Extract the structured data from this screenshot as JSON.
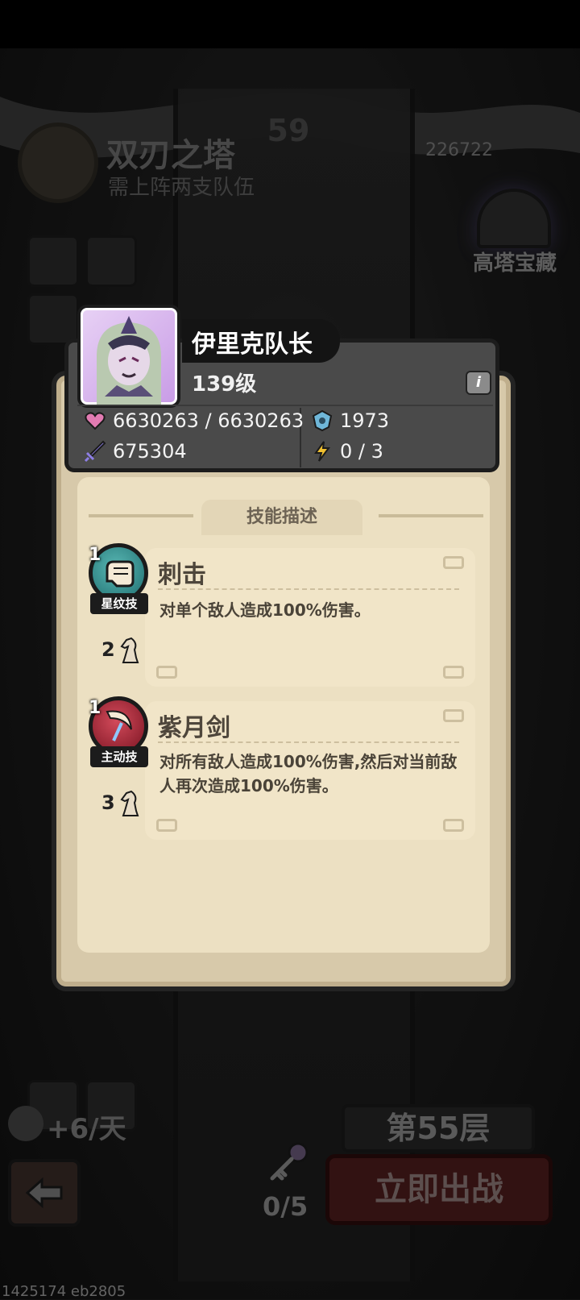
{
  "background": {
    "tower_name": "双刃之塔",
    "tower_requirement": "需上阵两支队伍",
    "floor_badge": "59",
    "enemy_power": "226722",
    "treasure_label": "高塔宝藏",
    "daily_bonus": "+6/天",
    "key_count": "0/5",
    "current_floor": "第55层",
    "fight_button": "立即出战",
    "build_info": "1425174 eb2805"
  },
  "hero": {
    "name": "伊里克队长",
    "level": "139级",
    "hp": "6630263 / 6630263",
    "defense": "1973",
    "attack": "675304",
    "energy": "0 / 3"
  },
  "skill_section_title": "技能描述",
  "skills": [
    {
      "name": "刺击",
      "type": "星纹技",
      "level": "1",
      "unlock_star": "2",
      "description": "对单个敌人造成100%伤害。",
      "icon": "fist-icon"
    },
    {
      "name": "紫月剑",
      "type": "主动技",
      "level": "1",
      "unlock_star": "3",
      "description": "对所有敌人造成100%伤害,然后对当前敌人再次造成100%伤害。",
      "icon": "crescent-sword-icon"
    }
  ],
  "colors": {
    "panel_bg": "#d7c9aa",
    "card_bg": "#f1e5c8",
    "header_bg": "#4a4a4a",
    "hp_icon": "#e27bb2",
    "defense_icon": "#6fb7d9",
    "attack_icon": "#8e7fe6",
    "energy_icon": "#f0c030"
  }
}
